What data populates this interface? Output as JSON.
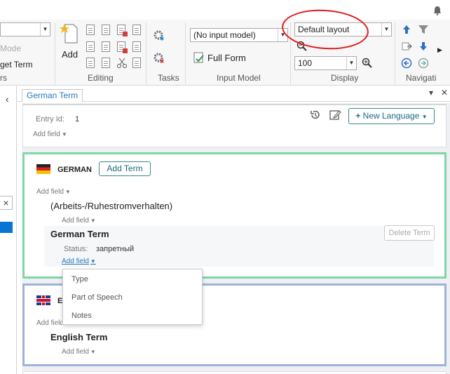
{
  "ribbon": {
    "mode_label": "Mode",
    "get_term_label": "get Term",
    "rs_label": "rs",
    "add_label": "Add",
    "groups": {
      "editing": "Editing",
      "tasks": "Tasks",
      "input_model": "Input Model",
      "display": "Display",
      "navigation": "Navigati"
    },
    "input_model_value": "(No input model)",
    "full_form_label": "Full Form",
    "layout_value": "Default layout",
    "zoom_value": "100"
  },
  "panel": {
    "tab_label": "German Term",
    "pin_icon": "▾",
    "close_icon": "✕"
  },
  "entry": {
    "id_label": "Entry Id:",
    "id_value": "1",
    "add_field": "Add field",
    "new_language": "New Language"
  },
  "german": {
    "language": "GERMAN",
    "add_term": "Add Term",
    "add_field": "Add field",
    "term1": "(Arbeits-/Ruhestromverhalten)",
    "term1_add_field": "Add field",
    "term2": "German Term",
    "delete_term": "Delete Term",
    "status_label": "Status:",
    "status_value": "запретный",
    "term2_add_field": "Add field"
  },
  "english": {
    "language_partial": "E",
    "add_field_partial": "Add field",
    "term": "English Term",
    "term_add_field": "Add field"
  },
  "dropdown": {
    "items": [
      "Type",
      "Part of Speech",
      "Notes"
    ]
  },
  "colors": {
    "german_border": "#7fd6a6",
    "english_border": "#9fb2dc",
    "accent": "#1b6a86",
    "annotation": "#e21b1b"
  }
}
